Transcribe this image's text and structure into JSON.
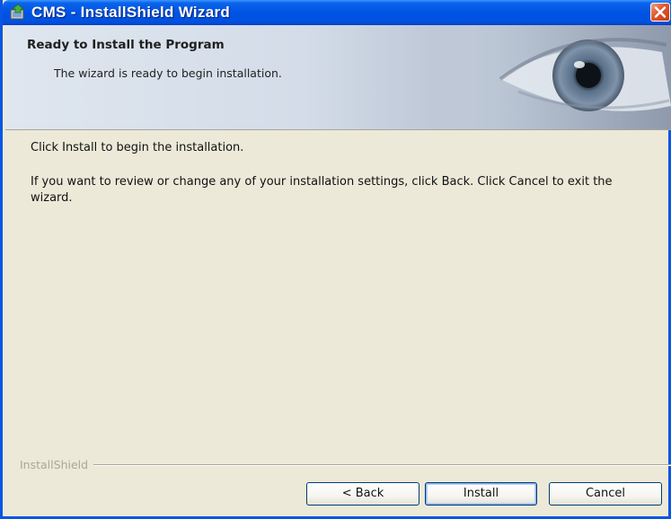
{
  "window": {
    "title": "CMS - InstallShield Wizard",
    "title_icon": "installer-icon",
    "close_icon": "close-icon"
  },
  "banner": {
    "title": "Ready to Install the Program",
    "subtitle": "The wizard is ready to begin installation.",
    "graphic": "eye-graphic"
  },
  "body": {
    "line1": "Click Install to begin the installation.",
    "line2": "If you want to review or change any of your installation settings, click Back. Click Cancel to exit the wizard."
  },
  "footer": {
    "brand": "InstallShield",
    "back_label": "< Back",
    "install_label": "Install",
    "cancel_label": "Cancel"
  },
  "colors": {
    "titlebar": "#0054e3",
    "dialog_bg": "#ece9d8",
    "close_button": "#e2552b",
    "button_border": "#003c74"
  }
}
